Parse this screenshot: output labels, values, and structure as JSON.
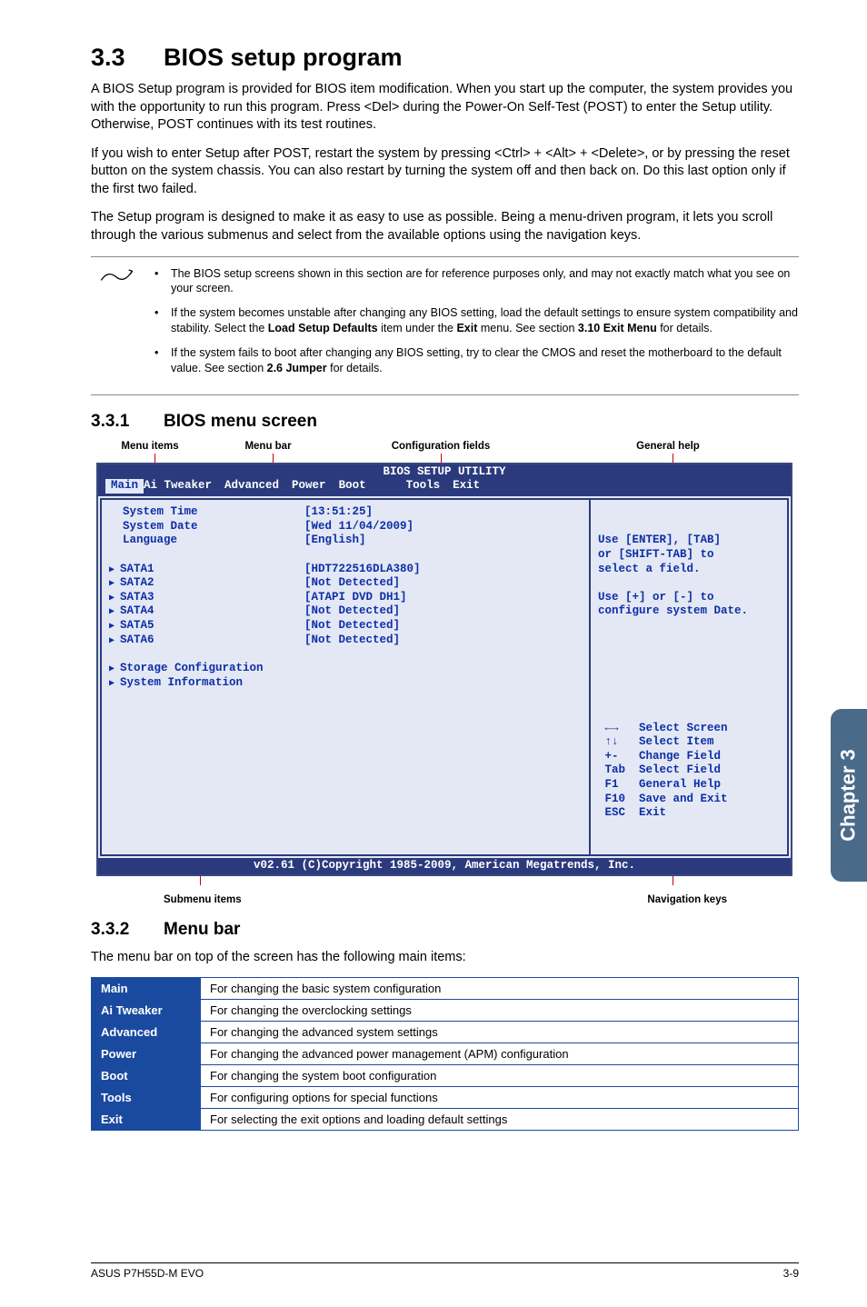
{
  "section": {
    "num": "3.3",
    "title": "BIOS setup program"
  },
  "paragraphs": {
    "p1": "A BIOS Setup program is provided for BIOS item modification. When you start up the computer, the system provides you with the opportunity to run this program. Press <Del> during the Power-On Self-Test (POST) to enter the Setup utility. Otherwise, POST continues with its test routines.",
    "p2": "If you wish to enter Setup after POST, restart the system by pressing <Ctrl> + <Alt> + <Delete>, or by pressing the reset button on the system chassis. You can also restart by turning the system off and then back on. Do this last option only if the first two failed.",
    "p3": "The Setup program is designed to make it as easy to use as possible. Being a menu-driven program, it lets you scroll through the various submenus and select from the available options using the navigation keys."
  },
  "notes": {
    "n1a": "The BIOS setup screens shown in this section are for reference purposes only, and may not exactly match what you see on your screen.",
    "n2a": "If the system becomes unstable after changing any BIOS setting, load the default settings to ensure system compatibility and stability. Select the ",
    "n2b": "Load Setup Defaults",
    "n2c": " item under the ",
    "n2d": "Exit",
    "n2e": " menu. See section ",
    "n2f": "3.10 Exit Menu",
    "n2g": " for details.",
    "n3a": "If the system fails to boot after changing any BIOS setting, try to clear the CMOS and reset the motherboard to the default value. See section ",
    "n3b": "2.6 Jumper",
    "n3c": " for details."
  },
  "sub331": {
    "num": "3.3.1",
    "title": "BIOS menu screen"
  },
  "labels_top": {
    "menu_items": "Menu items",
    "menu_bar": "Menu bar",
    "config_fields": "Configuration fields",
    "general_help": "General help"
  },
  "bios": {
    "title": "BIOS SETUP UTILITY",
    "menubar": [
      "Main",
      "Ai Tweaker",
      "Advanced",
      "Power",
      "Boot",
      "Tools",
      "Exit"
    ],
    "left_names": [
      {
        "t": "System Time",
        "tri": false
      },
      {
        "t": "System Date",
        "tri": false
      },
      {
        "t": "Language",
        "tri": false
      },
      {
        "t": "",
        "tri": false
      },
      {
        "t": "SATA1",
        "tri": true
      },
      {
        "t": "SATA2",
        "tri": true
      },
      {
        "t": "SATA3",
        "tri": true
      },
      {
        "t": "SATA4",
        "tri": true
      },
      {
        "t": "SATA5",
        "tri": true
      },
      {
        "t": "SATA6",
        "tri": true
      },
      {
        "t": "",
        "tri": false
      },
      {
        "t": "Storage Configuration",
        "tri": true
      },
      {
        "t": "System Information",
        "tri": true
      }
    ],
    "left_vals": [
      "[13:51:25]",
      "[Wed 11/04/2009]",
      "[English]",
      "",
      "[HDT722516DLA380]",
      "[Not Detected]",
      "[ATAPI DVD DH1]",
      "[Not Detected]",
      "[Not Detected]",
      "[Not Detected]"
    ],
    "right_top": "Use [ENTER], [TAB]\nor [SHIFT-TAB] to\nselect a field.\n\nUse [+] or [-] to\nconfigure system Date.",
    "right_bottom": " ←→   Select Screen\n ↑↓   Select Item\n +-   Change Field\n Tab  Select Field\n F1   General Help\n F10  Save and Exit\n ESC  Exit",
    "footer": "v02.61 (C)Copyright 1985-2009, American Megatrends, Inc."
  },
  "labels_bottom": {
    "submenu": "Submenu items",
    "navkeys": "Navigation keys"
  },
  "sub332": {
    "num": "3.3.2",
    "title": "Menu bar"
  },
  "menubar_intro": "The menu bar on top of the screen has the following main items:",
  "menutable": [
    {
      "k": "Main",
      "v": "For changing the basic system configuration"
    },
    {
      "k": "Ai Tweaker",
      "v": "For changing the overclocking settings"
    },
    {
      "k": "Advanced",
      "v": "For changing the advanced system settings"
    },
    {
      "k": "Power",
      "v": "For changing the advanced power management (APM) configuration"
    },
    {
      "k": "Boot",
      "v": "For changing the system boot configuration"
    },
    {
      "k": "Tools",
      "v": "For configuring options for special functions"
    },
    {
      "k": "Exit",
      "v": "For selecting the exit options and loading default settings"
    }
  ],
  "side_tab": "Chapter 3",
  "footer": {
    "left": "ASUS P7H55D-M EVO",
    "right": "3-9"
  }
}
